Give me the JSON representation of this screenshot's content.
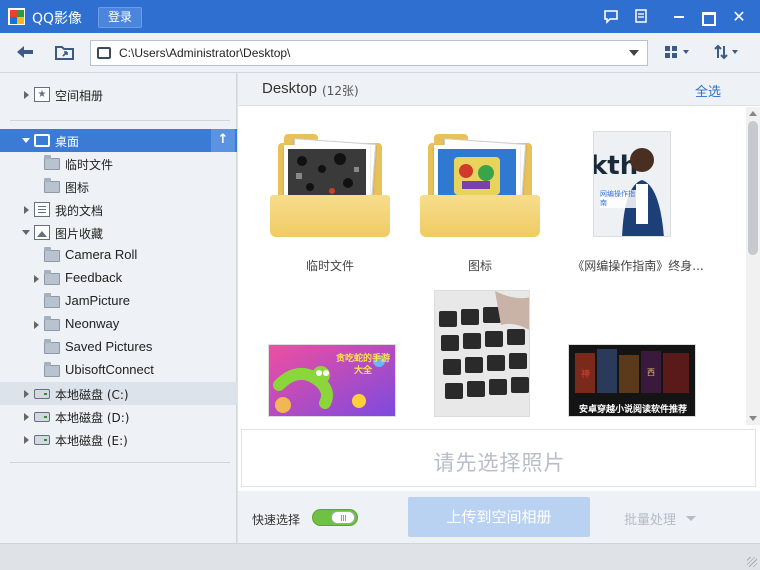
{
  "app": {
    "title": "QQ影像",
    "login_label": "登录"
  },
  "toolbar": {
    "path": "C:\\Users\\Administrator\\Desktop\\"
  },
  "sidebar": {
    "items": [
      {
        "label": "空间相册",
        "icon": "star-icon"
      },
      {
        "label": "桌面",
        "icon": "desktop-icon",
        "selected": true
      },
      {
        "label": "临时文件",
        "icon": "folder-icon"
      },
      {
        "label": "图标",
        "icon": "folder-icon"
      },
      {
        "label": "我的文档",
        "icon": "document-icon"
      },
      {
        "label": "图片收藏",
        "icon": "picture-icon"
      },
      {
        "label": "Camera Roll",
        "icon": "folder-icon"
      },
      {
        "label": "Feedback",
        "icon": "folder-icon"
      },
      {
        "label": "JamPicture",
        "icon": "folder-icon"
      },
      {
        "label": "Neonway",
        "icon": "folder-icon"
      },
      {
        "label": "Saved Pictures",
        "icon": "folder-icon"
      },
      {
        "label": "UbisoftConnect",
        "icon": "folder-icon"
      },
      {
        "label": "本地磁盘 (C:)",
        "icon": "disk-icon"
      },
      {
        "label": "本地磁盘 (D:)",
        "icon": "disk-icon"
      },
      {
        "label": "本地磁盘 (E:)",
        "icon": "disk-icon"
      }
    ]
  },
  "main": {
    "folder_name": "Desktop",
    "count": "(12张)",
    "select_all": "全选",
    "thumbnails": [
      {
        "caption": "临时文件",
        "type": "folder"
      },
      {
        "caption": "图标",
        "type": "folder"
      },
      {
        "caption": "《网编操作指南》终身...",
        "type": "image"
      },
      {
        "caption": "",
        "type": "image"
      },
      {
        "caption": "",
        "type": "image"
      },
      {
        "caption": "",
        "type": "image"
      }
    ],
    "thumb_text": {
      "manual_cover": "网编操作指南",
      "snake_game": "贪吃蛇的手游大全",
      "novel_reader": "安卓穿越小说阅读软件推荐"
    },
    "select_hint": "请先选择照片",
    "quick_select_label": "快速选择",
    "upload_label": "上传到空间相册",
    "batch_label": "批量处理"
  },
  "colors": {
    "titlebar": "#2f6fd0",
    "selected": "#3b7ad5",
    "toggle_on": "#72c043",
    "upload_disabled": "#b9d2f1"
  }
}
